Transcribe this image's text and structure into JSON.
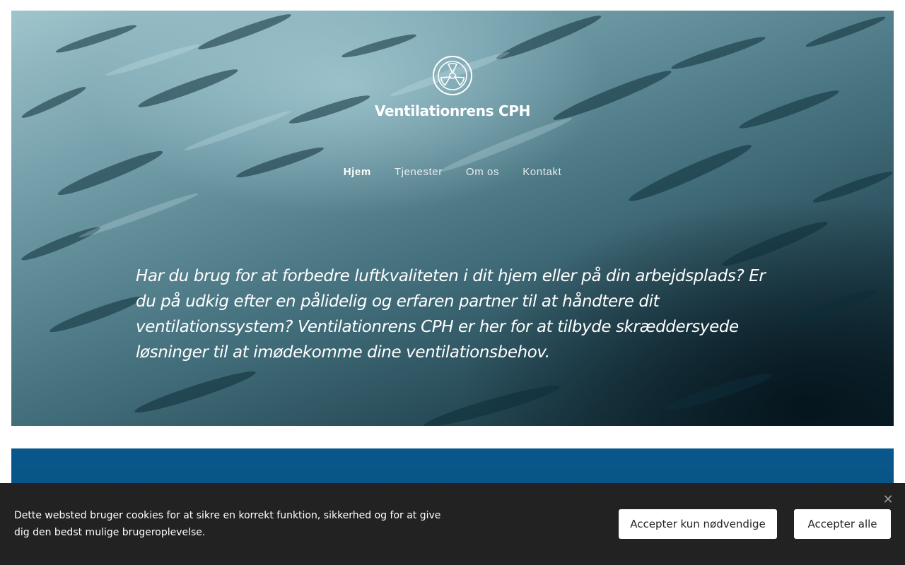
{
  "header": {
    "logo_icon": "ventilation-fan-icon",
    "brand": "Ventilationrens CPH"
  },
  "nav": {
    "items": [
      {
        "label": "Hjem",
        "active": true
      },
      {
        "label": "Tjenester",
        "active": false
      },
      {
        "label": "Om os",
        "active": false
      },
      {
        "label": "Kontakt",
        "active": false
      }
    ]
  },
  "hero": {
    "intro": "Har du brug for at forbedre luftkvaliteten i dit hjem eller på din arbejdsplads? Er du på udkig efter en pålidelig og erfaren partner til at håndtere dit ventilationssystem? Ventilationrens CPH er her for at tilbyde skræddersyede løsninger til at imødekomme dine ventilationsbehov."
  },
  "cookie_banner": {
    "text": "Dette websted bruger cookies for at sikre en korrekt funktion, sikkerhed og for at give dig den bedst mulige brugeroplevelse.",
    "close_icon": "close-icon",
    "accept_necessary_label": "Accepter kun nødvendige",
    "accept_all_label": "Accepter alle"
  },
  "colors": {
    "section_blue": "#08578c",
    "banner_bg": "#222222"
  }
}
